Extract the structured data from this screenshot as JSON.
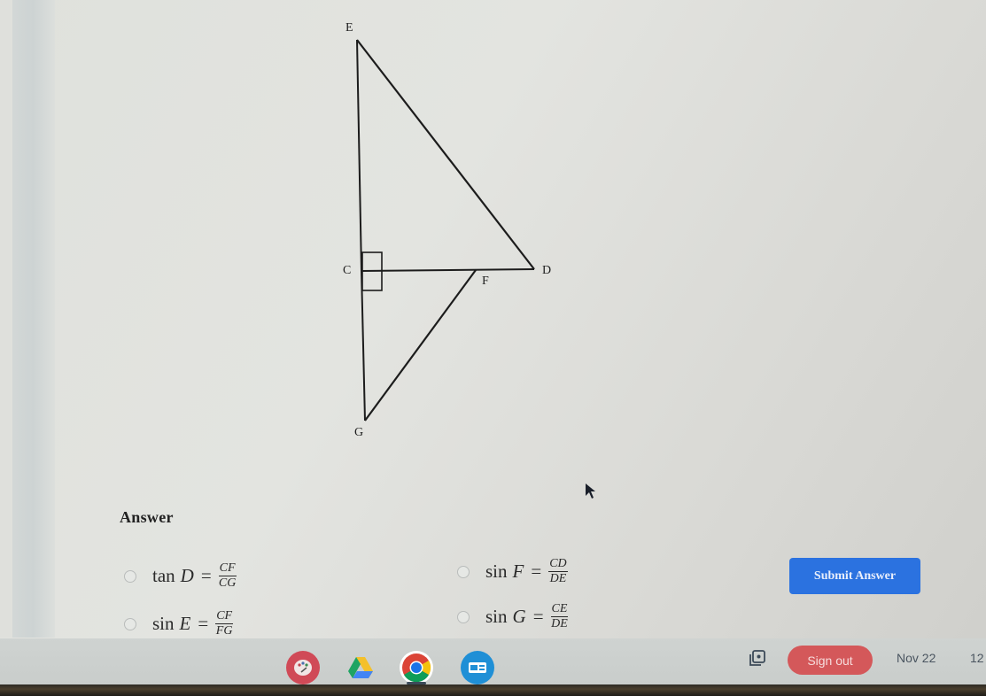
{
  "figure": {
    "vertices": {
      "E": {
        "label": "E"
      },
      "C": {
        "label": "C"
      },
      "D": {
        "label": "D"
      },
      "F": {
        "label": "F"
      },
      "G": {
        "label": "G"
      }
    },
    "segments": [
      "EC",
      "CG",
      "ED",
      "CD",
      "FG"
    ],
    "right_angle_at": "C"
  },
  "answer": {
    "heading": "Answer",
    "options": [
      {
        "fn": "tan",
        "var": "D",
        "eq": "=",
        "num": "CF",
        "den": "CG"
      },
      {
        "fn": "sin",
        "var": "E",
        "eq": "=",
        "num": "CF",
        "den": "FG"
      },
      {
        "fn": "sin",
        "var": "F",
        "eq": "=",
        "num": "CD",
        "den": "DE"
      },
      {
        "fn": "sin",
        "var": "G",
        "eq": "=",
        "num": "CE",
        "den": "DE"
      }
    ],
    "submit_label": "Submit Answer"
  },
  "shelf": {
    "apps": [
      {
        "name": "Canvas / Paint",
        "icon": "palette-icon",
        "color": "#d04a57"
      },
      {
        "name": "Google Drive",
        "icon": "drive-icon",
        "color": "#ffffff"
      },
      {
        "name": "Chrome",
        "icon": "chrome-icon",
        "color": "#ffffff"
      },
      {
        "name": "Classroom / Screencast",
        "icon": "screencast-icon",
        "color": "#1f8fd6"
      }
    ],
    "signout_label": "Sign out",
    "date": "Nov 22",
    "time": "12"
  },
  "colors": {
    "accent": "#2b72e0",
    "signout": "#d4585a"
  }
}
